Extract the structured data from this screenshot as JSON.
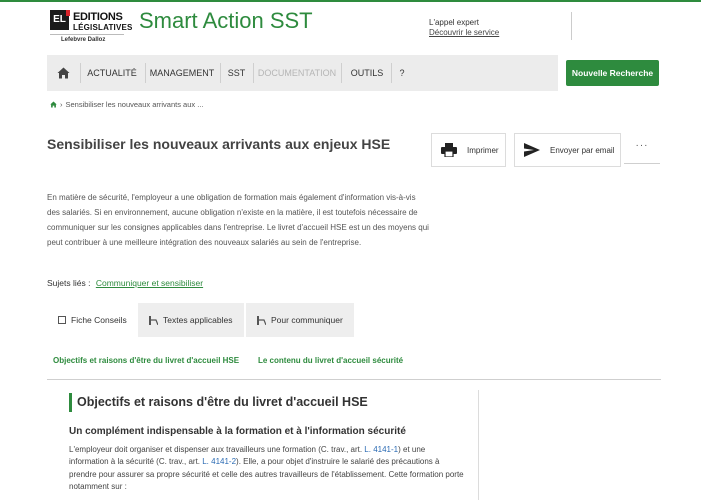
{
  "header": {
    "logo": {
      "mark": "EL",
      "line1": "EDITIONS",
      "line2": "LÉGISLATIVES",
      "line3": "Lefebvre Dalloz"
    },
    "app_title": "Smart Action SST",
    "expert": {
      "label": "L'appel expert",
      "link": "Découvrir le service"
    }
  },
  "nav": {
    "items": [
      {
        "label": "ACTUALITÉ",
        "disabled": false
      },
      {
        "label": "MANAGEMENT",
        "disabled": false
      },
      {
        "label": "SST",
        "disabled": false
      },
      {
        "label": "DOCUMENTATION",
        "disabled": true
      },
      {
        "label": "OUTILS",
        "disabled": false
      },
      {
        "label": "?",
        "disabled": false
      }
    ],
    "new_search": "Nouvelle Recherche"
  },
  "breadcrumb": {
    "separator": "›",
    "current": "Sensibiliser les nouveaux arrivants aux ..."
  },
  "page": {
    "title": "Sensibiliser les nouveaux arrivants aux enjeux HSE",
    "print_label": "Imprimer",
    "email_label": "Envoyer par email",
    "more_label": "···",
    "intro_lines": [
      "En matière de sécurité, l'employeur a une obligation de formation mais également d'information vis-à-vis",
      "des salariés. Si en environnement, aucune obligation n'existe en la matière, il est toutefois nécessaire de",
      "communiquer sur les consignes applicables dans l'entreprise. Le livret d'accueil HSE est un des moyens qui",
      "peut contribuer à une meilleure intégration des nouveaux salariés au sein de l'entreprise."
    ],
    "related_label": "Sujets liés :",
    "related_link": "Communiquer et sensibiliser"
  },
  "tabs": [
    {
      "label": "Fiche Conseils",
      "icon": "document-icon",
      "active": true
    },
    {
      "label": "Textes applicables",
      "icon": "gavel-icon",
      "active": false
    },
    {
      "label": "Pour communiquer",
      "icon": "megaphone-icon",
      "active": false
    }
  ],
  "sub_links": [
    "Objectifs et raisons d'être du livret d'accueil HSE",
    "Le contenu du livret d'accueil sécurité"
  ],
  "content": {
    "h2": "Objectifs et raisons d'être du livret d'accueil HSE",
    "h3": "Un complément indispensable à la formation et à l'information sécurité",
    "p1_a": "L'employeur doit organiser et dispenser aux travailleurs une formation (C. trav., art. ",
    "p1_ref1": "L. 4141-1",
    "p1_b": ") et une information à la sécurité (C. trav., art. ",
    "p1_ref2": "L. 4141-2",
    "p1_c": "). Elle, a pour objet d'instruire le salarié des précautions à prendre pour assurer sa propre sécurité et celle des autres travailleurs de l'établissement. Cette formation porte notamment sur :"
  },
  "colors": {
    "brand_green": "#2e8b3e",
    "link_blue": "#2a6ab3",
    "nav_bg": "#ececec"
  }
}
